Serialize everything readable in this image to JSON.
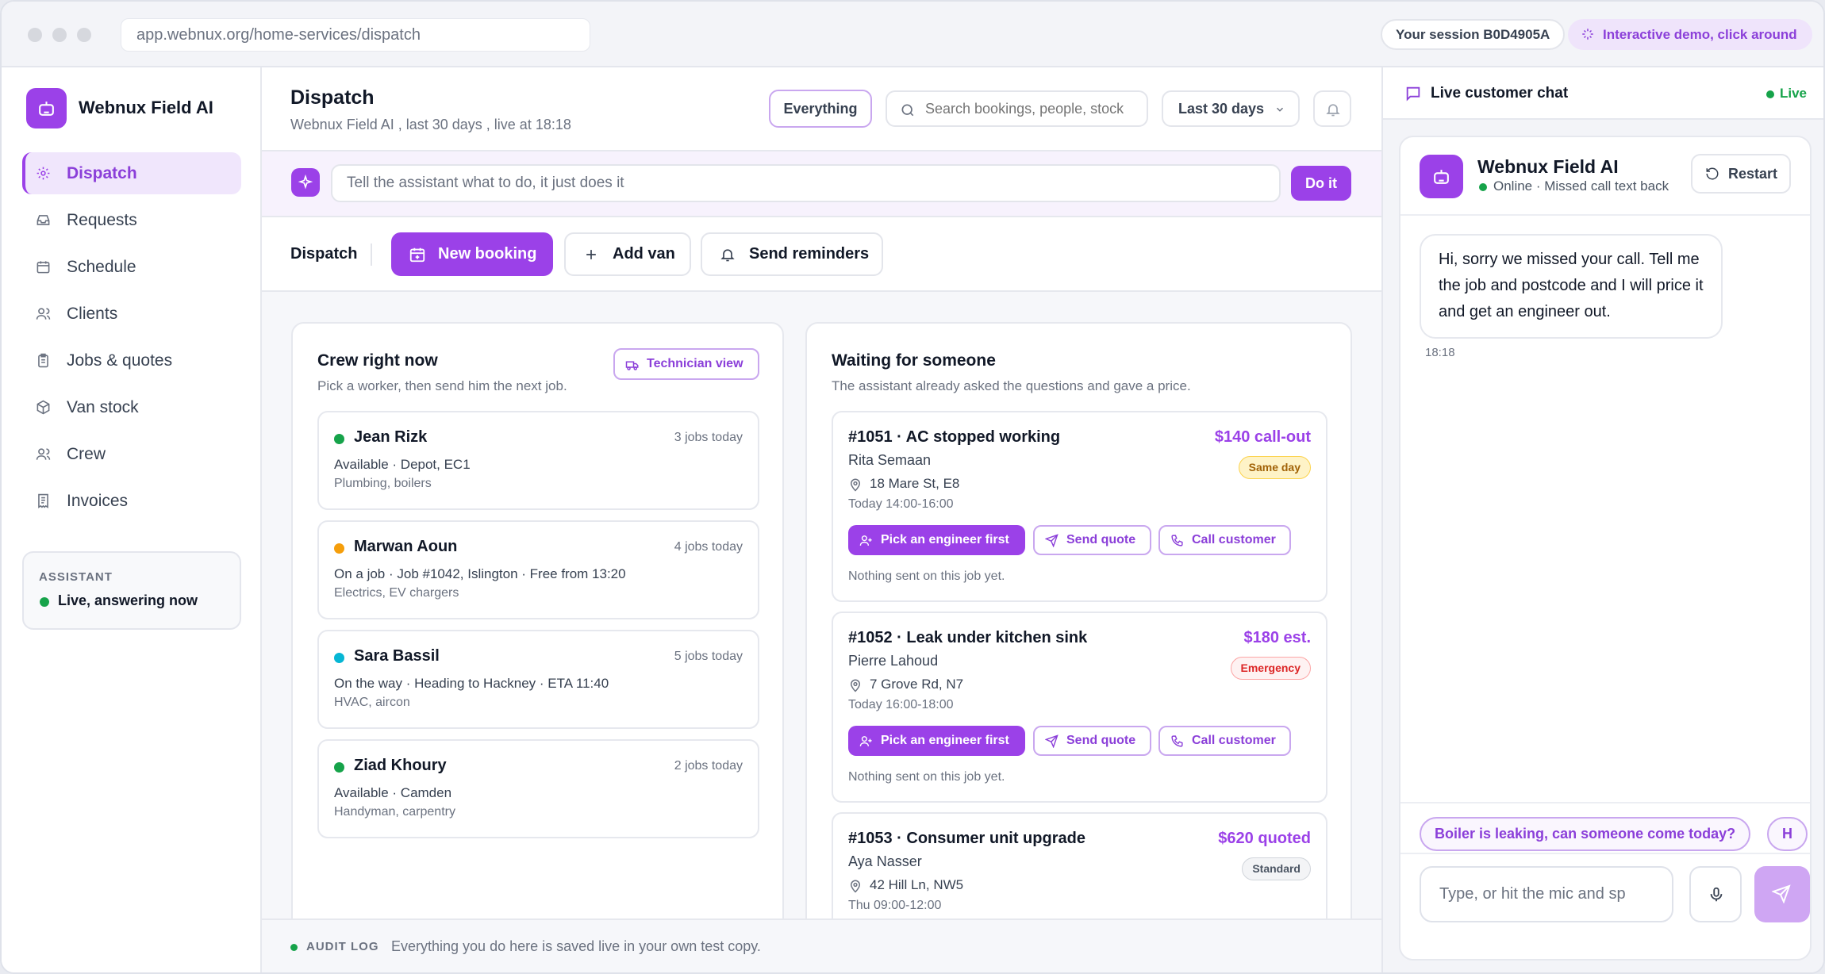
{
  "browser": {
    "url": "app.webnux.org/home-services/dispatch",
    "session": "Your session B0D4905A",
    "demo_label": "Interactive demo, click around"
  },
  "sidebar": {
    "brand": "Webnux Field AI",
    "items": [
      {
        "label": "Dispatch",
        "icon": "gear-icon",
        "active": true
      },
      {
        "label": "Requests",
        "icon": "inbox-icon"
      },
      {
        "label": "Schedule",
        "icon": "calendar-icon"
      },
      {
        "label": "Clients",
        "icon": "users-icon"
      },
      {
        "label": "Jobs & quotes",
        "icon": "clipboard-icon"
      },
      {
        "label": "Van stock",
        "icon": "box-icon"
      },
      {
        "label": "Crew",
        "icon": "users-icon"
      },
      {
        "label": "Invoices",
        "icon": "receipt-icon"
      }
    ],
    "assistant": {
      "title": "ASSISTANT",
      "status": "Live, answering now"
    }
  },
  "header": {
    "title": "Dispatch",
    "subtitle": "Webnux Field AI , last 30 days , live at 18:18",
    "filter_label": "Everything",
    "search_placeholder": "Search bookings, people, stock",
    "range_label": "Last 30 days"
  },
  "command": {
    "placeholder": "Tell the assistant what to do, it just does it",
    "do_label": "Do it"
  },
  "actions": {
    "label": "Dispatch",
    "new_booking": "New booking",
    "add_van": "Add van",
    "send_reminders": "Send reminders"
  },
  "crew_panel": {
    "title": "Crew right now",
    "subtitle": "Pick a worker, then send him the next job.",
    "view_button": "Technician view",
    "crew": [
      {
        "name": "Jean Rizk",
        "jobs": "3 jobs today",
        "status": "Available · Depot, EC1",
        "skills": "Plumbing, boilers",
        "color": "#16a34a"
      },
      {
        "name": "Marwan Aoun",
        "jobs": "4 jobs today",
        "status": "On a job · Job #1042, Islington · Free from 13:20",
        "skills": "Electrics, EV chargers",
        "color": "#f59e0b"
      },
      {
        "name": "Sara Bassil",
        "jobs": "5 jobs today",
        "status": "On the way · Heading to Hackney · ETA 11:40",
        "skills": "HVAC, aircon",
        "color": "#06b6d4"
      },
      {
        "name": "Ziad Khoury",
        "jobs": "2 jobs today",
        "status": "Available · Camden",
        "skills": "Handyman, carpentry",
        "color": "#16a34a"
      }
    ]
  },
  "waiting_panel": {
    "title": "Waiting for someone",
    "subtitle": "The assistant already asked the questions and gave a price.",
    "pick_label": "Pick an engineer first",
    "quote_label": "Send quote",
    "call_label": "Call customer",
    "jobs": [
      {
        "title": "#1051 · AC stopped working",
        "client": "Rita Semaan",
        "address": "18 Mare St, E8",
        "time": "Today 14:00-16:00",
        "price": "$140 call-out",
        "badge": "Same day",
        "badge_kind": "sameday",
        "note": "Nothing sent on this job yet."
      },
      {
        "title": "#1052 · Leak under kitchen sink",
        "client": "Pierre Lahoud",
        "address": "7 Grove Rd, N7",
        "time": "Today 16:00-18:00",
        "price": "$180 est.",
        "badge": "Emergency",
        "badge_kind": "emergency",
        "note": "Nothing sent on this job yet."
      },
      {
        "title": "#1053 · Consumer unit upgrade",
        "client": "Aya Nasser",
        "address": "42 Hill Ln, NW5",
        "time": "Thu 09:00-12:00",
        "price": "$620 quoted",
        "badge": "Standard",
        "badge_kind": "standard",
        "note": ""
      }
    ]
  },
  "audit": {
    "title": "AUDIT LOG",
    "text": "Everything you do here is saved live in your own test copy."
  },
  "chat": {
    "header_title": "Live customer chat",
    "live_label": "Live",
    "bot_name": "Webnux Field AI",
    "bot_status": "Online · Missed call text back",
    "restart_label": "Restart",
    "message": "Hi, sorry we missed your call. Tell me the job and postcode and I will price it and get an engineer out.",
    "message_time": "18:18",
    "chips": [
      "Boiler is leaking, can someone come today?",
      "H"
    ],
    "input_placeholder": "Type, or hit the mic and sp"
  },
  "colors": {
    "accent": "#9b41e8",
    "accent_light": "#f0e6fc",
    "live_green": "#16a34a"
  }
}
